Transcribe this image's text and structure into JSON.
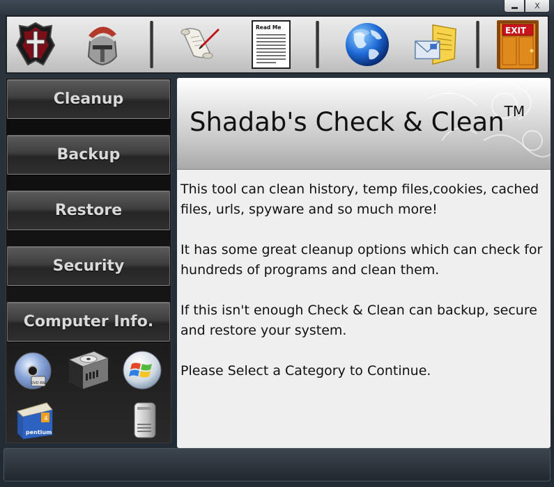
{
  "window": {
    "minimize_icon": "minimize-icon",
    "close_label": "X"
  },
  "toolbar": {
    "buttons": [
      {
        "name": "shield-cross-icon"
      },
      {
        "name": "knight-helmet-icon"
      },
      {
        "name": "scroll-quill-icon"
      },
      {
        "name": "readme-document-icon",
        "label": "Read Me"
      },
      {
        "name": "globe-icon"
      },
      {
        "name": "mail-envelope-icon"
      },
      {
        "name": "exit-door-icon",
        "label": "EXIT"
      }
    ]
  },
  "sidebar": {
    "items": [
      {
        "label": "Cleanup"
      },
      {
        "label": "Backup"
      },
      {
        "label": "Restore"
      },
      {
        "label": "Security"
      },
      {
        "label": "Computer Info."
      }
    ],
    "hardware_icons": [
      {
        "name": "dvd-disc-icon",
        "label": "DVD RW"
      },
      {
        "name": "hard-drive-icon"
      },
      {
        "name": "windows-logo-icon"
      },
      {
        "name": "processor-chip-icon",
        "label": "pentium 4"
      },
      {
        "name": "computer-tower-icon"
      }
    ]
  },
  "main": {
    "title": "Shadab's Check & Clean",
    "trademark": "TM",
    "paragraphs": [
      "This tool can clean history, temp files,cookies, cached files, urls, spyware and so much more!",
      "It has some great cleanup options which can check for hundreds of programs and clean them.",
      "If this isn't enough Check & Clean can backup, secure and restore your system.",
      "Please Select a Category to Continue."
    ]
  },
  "colors": {
    "window_frame": "#2b333d",
    "toolbar_bg": "#d9d9d9",
    "sidebar_bg": "#151515",
    "nav_button_text": "#d9d9d9",
    "content_bg": "#efefef",
    "exit_door": "#e08a1e"
  }
}
